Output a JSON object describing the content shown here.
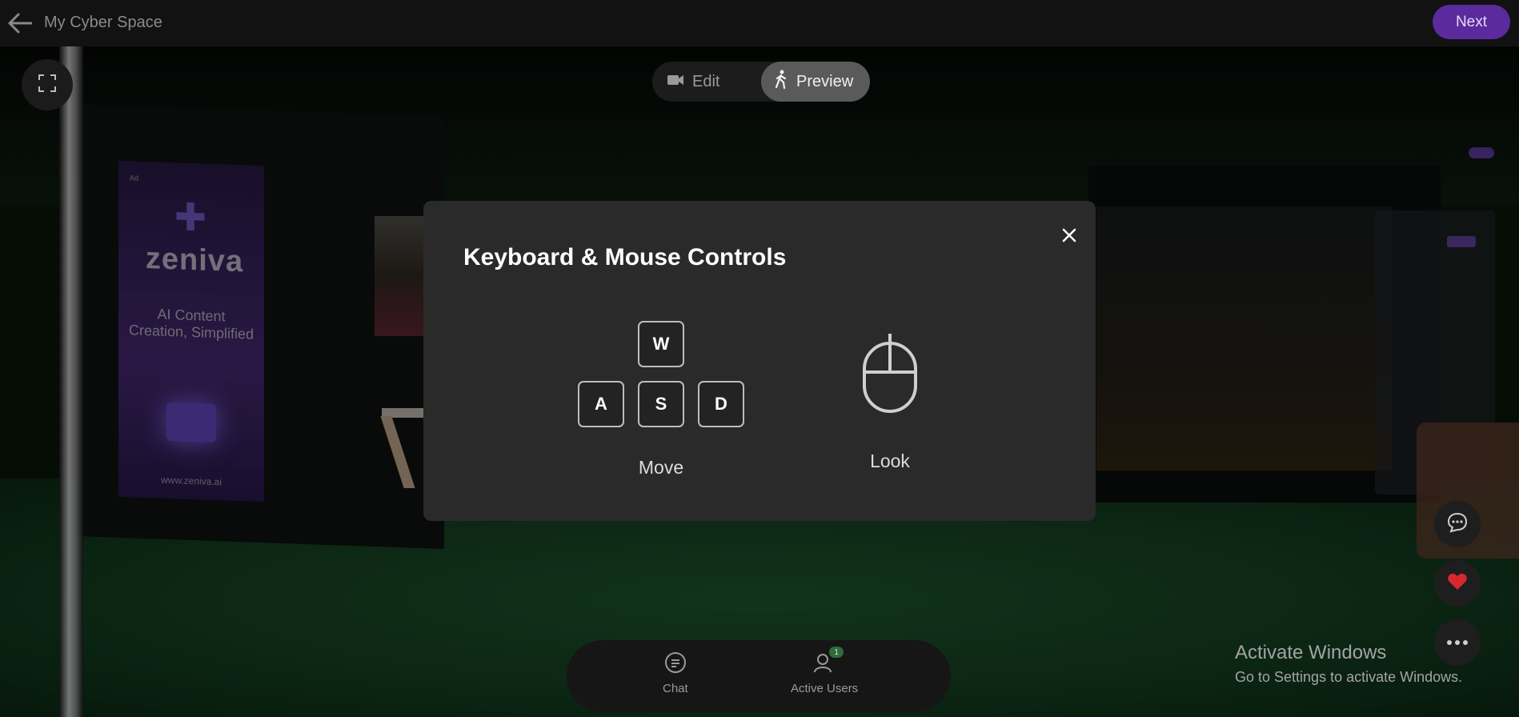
{
  "header": {
    "title": "My Cyber Space",
    "next_label": "Next"
  },
  "mode_toggle": {
    "edit_label": "Edit",
    "preview_label": "Preview",
    "active": "Preview"
  },
  "scene": {
    "banner": {
      "ad_label": "Ad",
      "brand": "zeniva",
      "tagline": "AI Content Creation, Simplified",
      "url": "www.zeniva.ai"
    }
  },
  "modal": {
    "title": "Keyboard & Mouse Controls",
    "keys": [
      "W",
      "A",
      "S",
      "D"
    ],
    "move_label": "Move",
    "look_label": "Look"
  },
  "bottom_bar": {
    "chat_label": "Chat",
    "active_users_label": "Active Users",
    "active_users_count": "1"
  },
  "watermark": {
    "title": "Activate Windows",
    "subtitle": "Go to Settings to activate Windows."
  },
  "colors": {
    "accent": "#5b2a9c",
    "heart": "#d8282f",
    "modal_bg": "#2a2a2a"
  }
}
